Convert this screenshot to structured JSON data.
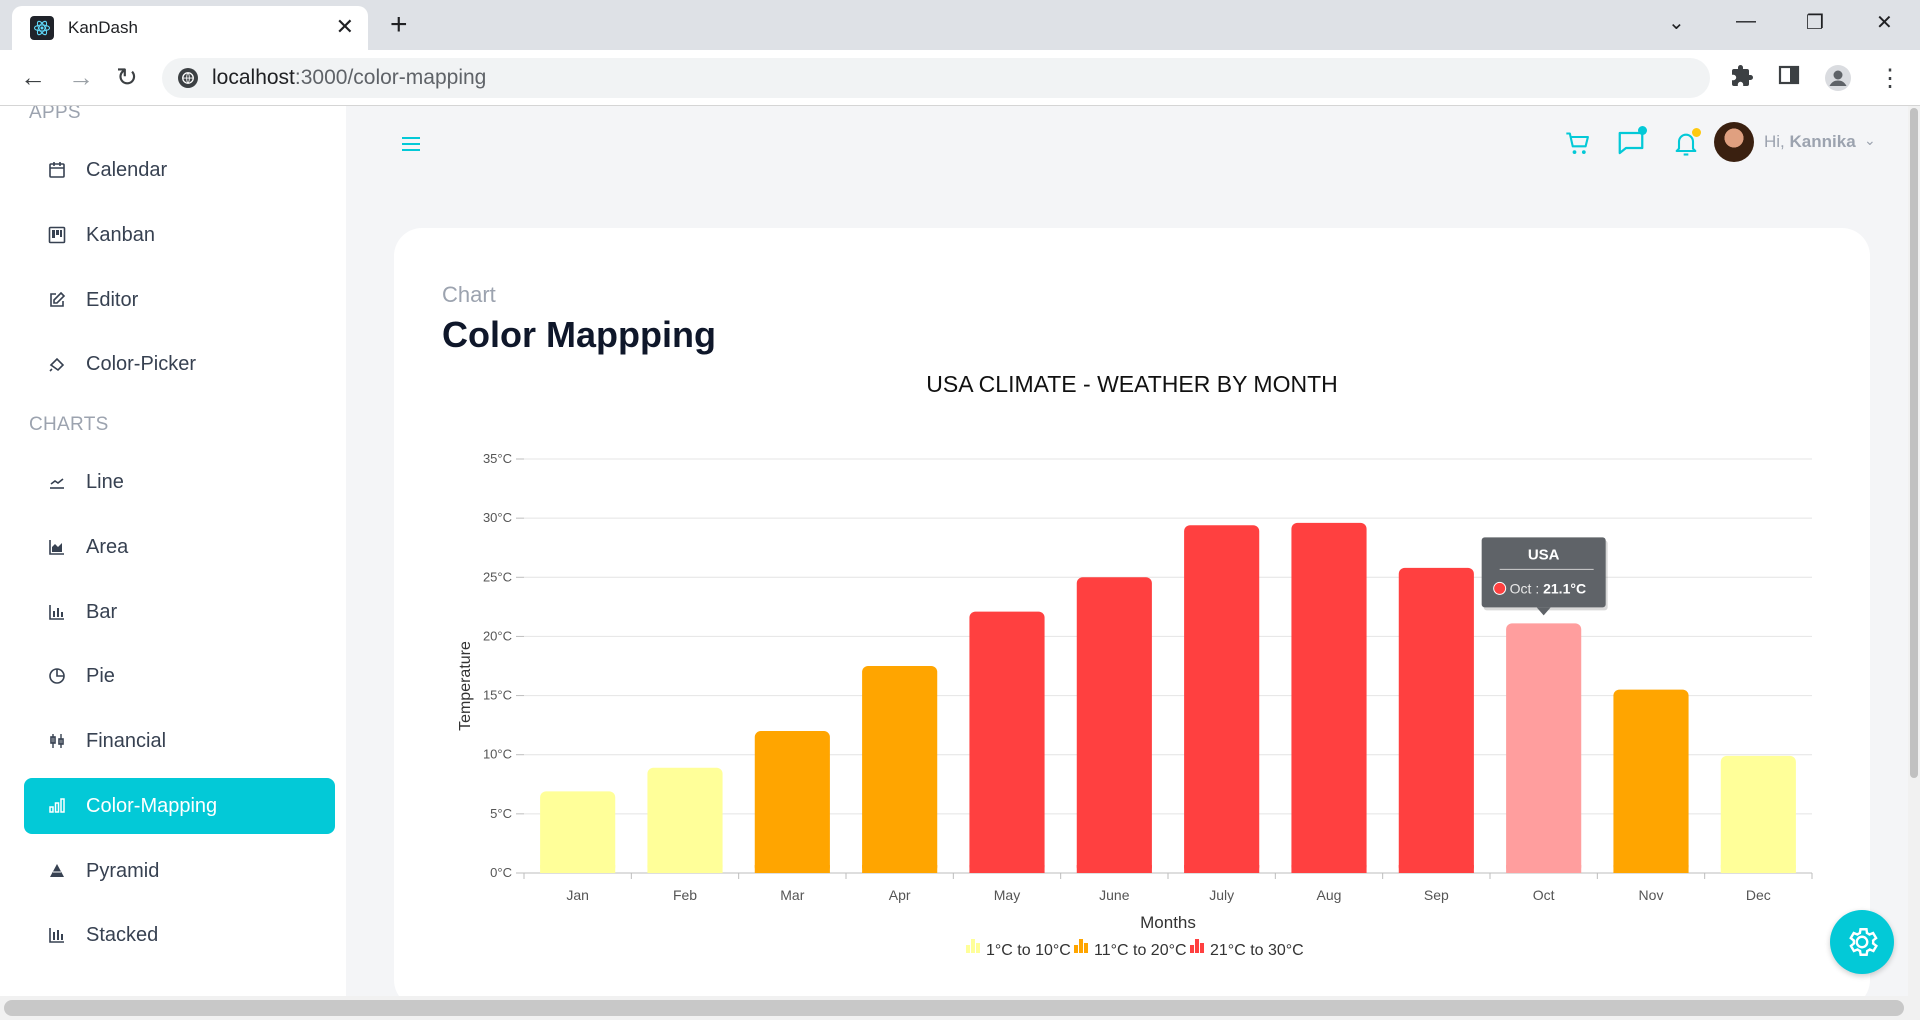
{
  "browser": {
    "tab_title": "KanDash",
    "url_host": "localhost",
    "url_path": ":3000/color-mapping"
  },
  "sidebar": {
    "sections": [
      {
        "title": "APPS",
        "items": [
          {
            "label": "Calendar",
            "icon": "calendar-icon"
          },
          {
            "label": "Kanban",
            "icon": "kanban-icon"
          },
          {
            "label": "Editor",
            "icon": "editor-icon"
          },
          {
            "label": "Color-Picker",
            "icon": "color-picker-icon"
          }
        ]
      },
      {
        "title": "CHARTS",
        "items": [
          {
            "label": "Line",
            "icon": "line-chart-icon"
          },
          {
            "label": "Area",
            "icon": "area-chart-icon"
          },
          {
            "label": "Bar",
            "icon": "bar-chart-icon"
          },
          {
            "label": "Pie",
            "icon": "pie-chart-icon"
          },
          {
            "label": "Financial",
            "icon": "financial-icon"
          },
          {
            "label": "Color-Mapping",
            "icon": "color-mapping-icon",
            "active": true
          },
          {
            "label": "Pyramid",
            "icon": "pyramid-icon"
          },
          {
            "label": "Stacked",
            "icon": "stacked-icon"
          }
        ]
      }
    ]
  },
  "header": {
    "greeting": "Hi,",
    "user_name": "Kannika",
    "accent_color": "#03c9d7",
    "chat_dot_color": "#03c9d7",
    "notification_dot_color": "#fec90f"
  },
  "page": {
    "category": "Chart",
    "title": "Color Mappping"
  },
  "chart_data": {
    "type": "bar",
    "title": "USA CLIMATE - WEATHER BY MONTH",
    "xlabel": "Months",
    "ylabel": "Temperature",
    "ylim": [
      0,
      35
    ],
    "yticks": [
      "0°C",
      "5°C",
      "10°C",
      "15°C",
      "20°C",
      "25°C",
      "30°C",
      "35°C"
    ],
    "grid": true,
    "categories": [
      "Jan",
      "Feb",
      "Mar",
      "Apr",
      "May",
      "June",
      "July",
      "Aug",
      "Sep",
      "Oct",
      "Nov",
      "Dec"
    ],
    "values": [
      6.9,
      8.9,
      12.0,
      17.5,
      22.1,
      25.0,
      29.4,
      29.6,
      25.8,
      21.1,
      15.5,
      9.9
    ],
    "color_ranges": [
      {
        "label": "1°C to 10°C",
        "color": "#FFFF99"
      },
      {
        "label": "11°C to 20°C",
        "color": "#FFA500"
      },
      {
        "label": "21°C to 30°C",
        "color": "#FF4040"
      }
    ],
    "legend_position": "bottom",
    "tooltip": {
      "header": "USA",
      "category": "Oct",
      "value": "21.1°C",
      "highlighted_index": 9,
      "highlight_color": "#FF9E9E"
    }
  }
}
